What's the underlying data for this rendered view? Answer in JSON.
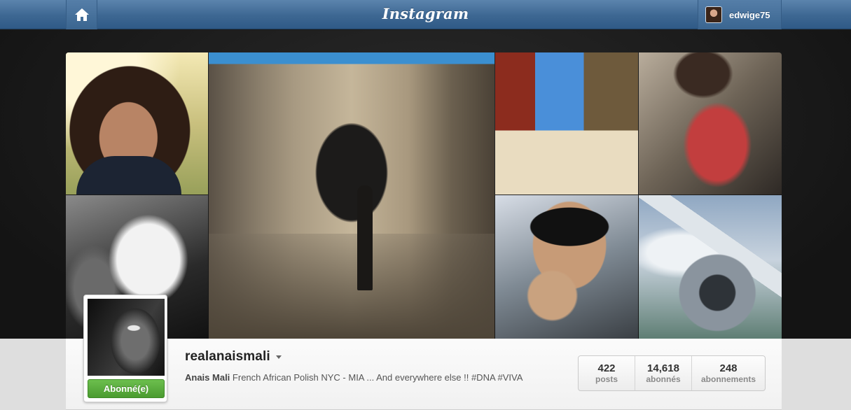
{
  "header": {
    "brand": "Instagram",
    "home_icon": "home-icon",
    "current_user": {
      "username": "edwige75"
    }
  },
  "profile": {
    "username": "realanaismali",
    "full_name": "Anais Mali",
    "bio": "French African Polish NYC - MIA ... And everywhere else !! #DNA #VIVA",
    "follow_button": "Abonné(e)",
    "stats": [
      {
        "count": "422",
        "label": "posts"
      },
      {
        "count": "14,618",
        "label": "abonnés"
      },
      {
        "count": "248",
        "label": "abonnements"
      }
    ]
  },
  "colors": {
    "topbar": "#3d6792",
    "follow_green": "#5aad3c",
    "background": "#1b1b1b"
  }
}
